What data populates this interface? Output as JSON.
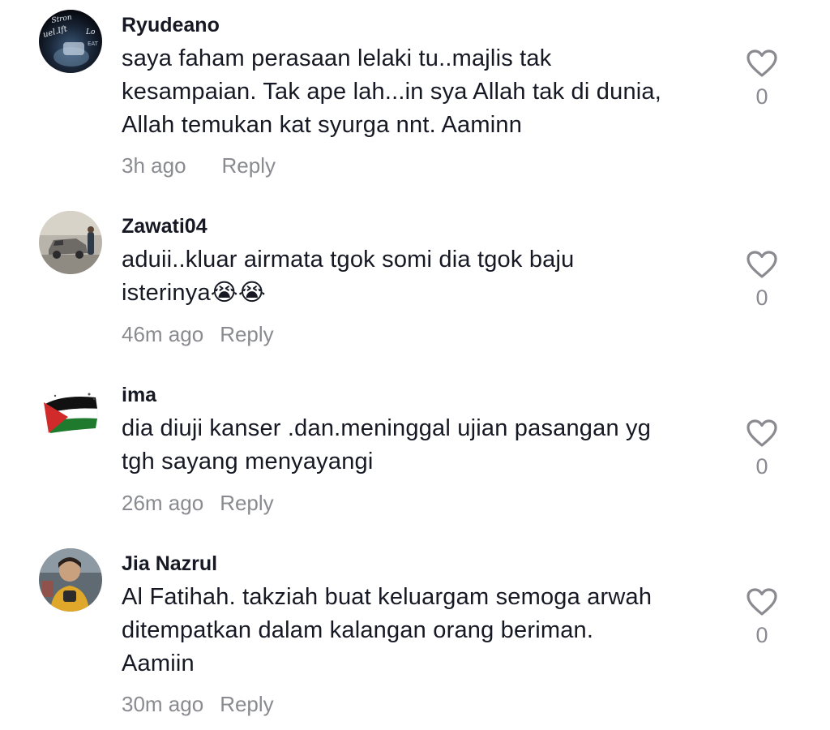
{
  "comments": [
    {
      "username": "Ryudeano",
      "lines": [
        "saya faham perasaan lelaki tu..majlis tak",
        "kesampaian. Tak ape lah...in sya Allah tak di dunia,",
        "Allah temukan kat syurga nnt. Aaminn"
      ],
      "time": "3h ago",
      "reply_label": "Reply",
      "likes": "0",
      "avatar_icon": "dark-photo-avatar",
      "avatar_logo_text": [
        "Stron",
        "uel.Ift",
        "Lo",
        "EAT"
      ]
    },
    {
      "username": "Zawati04",
      "lines": [
        "aduii..kluar airmata tgok somi dia tgok baju",
        "isterinya😭😭"
      ],
      "time": "46m ago",
      "reply_label": "Reply",
      "likes": "0",
      "avatar_icon": "car-photo-avatar"
    },
    {
      "username": "ima",
      "lines": [
        "dia diuji kanser .dan.meninggal ujian pasangan yg",
        "tgh sayang menyayangi"
      ],
      "time": "26m ago",
      "reply_label": "Reply",
      "likes": "0",
      "avatar_icon": "palestine-flag-avatar"
    },
    {
      "username": "Jia Nazrul",
      "lines": [
        "Al Fatihah. takziah buat keluargam semoga arwah",
        "ditempatkan dalam kalangan orang beriman.",
        "Aamiin"
      ],
      "time": "30m ago",
      "reply_label": "Reply",
      "likes": "0",
      "avatar_icon": "person-photo-avatar"
    }
  ],
  "colors": {
    "text": "#161823",
    "secondary": "#8a8b91",
    "background": "#ffffff"
  }
}
